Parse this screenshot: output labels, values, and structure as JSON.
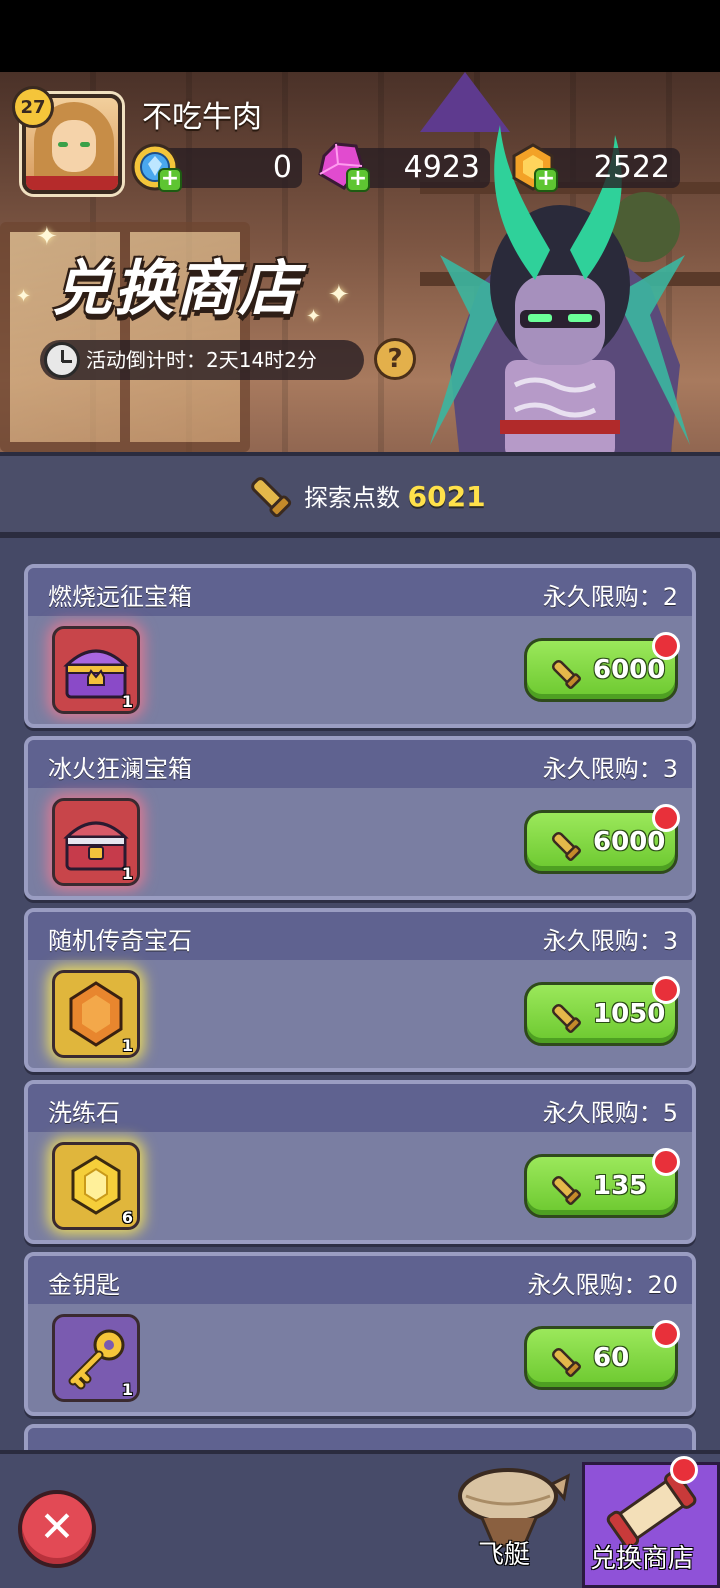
{
  "player": {
    "level": "27",
    "name": "不吃牛肉"
  },
  "currencies": [
    {
      "icon": "blue-gem-coin-icon",
      "value": "0"
    },
    {
      "icon": "pink-crystal-icon",
      "value": "4923"
    },
    {
      "icon": "gold-coin-icon",
      "value": "2522"
    }
  ],
  "shop": {
    "title": "兑换商店",
    "countdown_label": "活动倒计时：2天14时2分",
    "help_label": "?"
  },
  "points": {
    "label": "探索点数",
    "value": "6021"
  },
  "items": [
    {
      "name": "燃烧远征宝箱",
      "limit": "永久限购：2",
      "count": "1",
      "price": "6000",
      "icon": "purple-chest-icon",
      "rarity": "red"
    },
    {
      "name": "冰火狂澜宝箱",
      "limit": "永久限购：3",
      "count": "1",
      "price": "6000",
      "icon": "silver-chest-icon",
      "rarity": "red"
    },
    {
      "name": "随机传奇宝石",
      "limit": "永久限购：3",
      "count": "1",
      "price": "1050",
      "icon": "orange-gem-icon",
      "rarity": "gold"
    },
    {
      "name": "洗练石",
      "limit": "永久限购：5",
      "count": "6",
      "price": "135",
      "icon": "yellow-stone-icon",
      "rarity": "gold"
    },
    {
      "name": "金钥匙",
      "limit": "永久限购：20",
      "count": "1",
      "price": "60",
      "icon": "gold-key-icon",
      "rarity": "purple"
    }
  ],
  "nav": {
    "close_label": "✕",
    "airship_label": "飞艇",
    "shop_label": "兑换商店"
  },
  "colors": {
    "accent_green": "#6cc82f",
    "alert_red": "#e8303a",
    "panel_purple": "#8f52d8",
    "points_yellow": "#ffe14a"
  }
}
